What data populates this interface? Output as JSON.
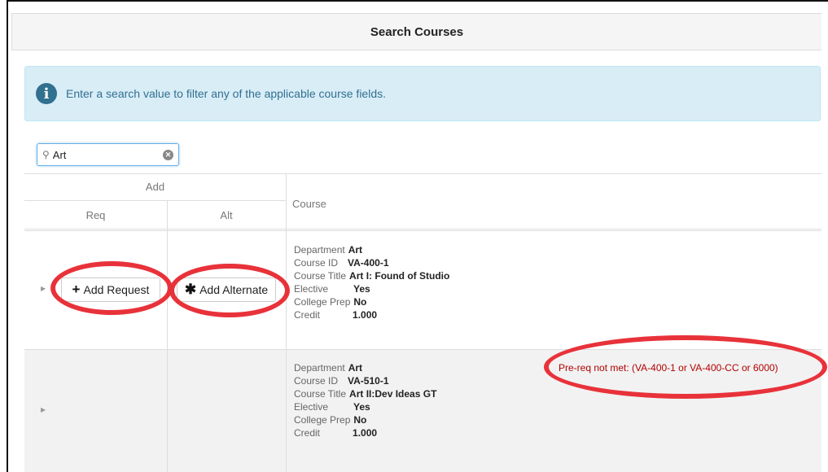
{
  "panel": {
    "title": "Search Courses"
  },
  "info": {
    "icon": "info-circle-icon",
    "text": "Enter a search value to filter any of the applicable course fields."
  },
  "search": {
    "value": "Art",
    "placeholder": ""
  },
  "table": {
    "headers": {
      "add": "Add",
      "req": "Req",
      "alt": "Alt",
      "course": "Course"
    },
    "rows": [
      {
        "department_label": "Department",
        "department": "Art",
        "course_id_label": "Course ID",
        "course_id": "VA-400-1",
        "course_title_label": "Course Title",
        "course_title": "Art I: Found of Studio",
        "elective_label": "Elective",
        "elective": "Yes",
        "college_prep_label": "College Prep",
        "college_prep": "No",
        "credit_label": "Credit",
        "credit": "1.000",
        "add_request_label": "Add Request",
        "add_alternate_label": "Add Alternate",
        "prereq": ""
      },
      {
        "department_label": "Department",
        "department": "Art",
        "course_id_label": "Course ID",
        "course_id": "VA-510-1",
        "course_title_label": "Course Title",
        "course_title": "Art II:Dev Ideas GT",
        "elective_label": "Elective",
        "elective": "Yes",
        "college_prep_label": "College Prep",
        "college_prep": "No",
        "credit_label": "Credit",
        "credit": "1.000",
        "prereq": "Pre-req not met: (VA-400-1 or VA-400-CC or 6000)"
      }
    ]
  },
  "colors": {
    "info_bg": "#d9edf7",
    "info_text": "#31708f",
    "annotation": "#e8323a",
    "prereq_text": "#b30000"
  }
}
